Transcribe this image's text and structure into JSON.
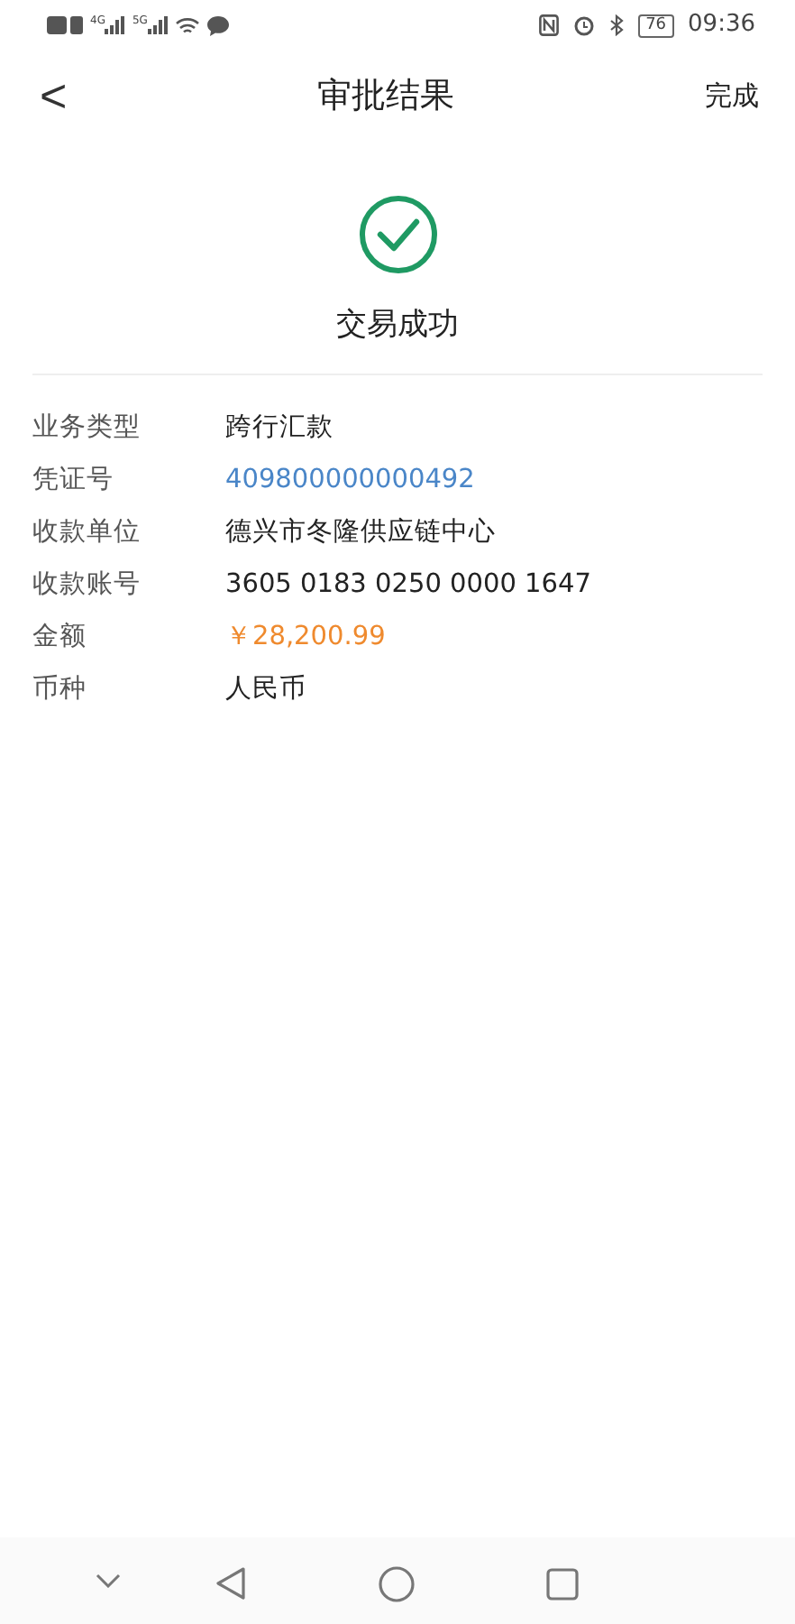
{
  "status_bar": {
    "signals": [
      {
        "label": "4G"
      },
      {
        "label": "5G"
      }
    ],
    "battery": "76",
    "time": "09:36"
  },
  "nav": {
    "back": "<",
    "title": "审批结果",
    "action": "完成"
  },
  "result": {
    "title": "交易成功",
    "success": true
  },
  "details": [
    {
      "label": "业务类型",
      "value": "跨行汇款",
      "kind": "plain"
    },
    {
      "label": "凭证号",
      "value": "409800000000492",
      "kind": "link"
    },
    {
      "label": "收款单位",
      "value": "德兴市冬隆供应链中心",
      "kind": "plain"
    },
    {
      "label": "收款账号",
      "value": "3605 0183 0250 0000 1647",
      "kind": "plain"
    },
    {
      "label": "金额",
      "value": "￥28,200.99",
      "kind": "amount"
    },
    {
      "label": "币种",
      "value": "人民币",
      "kind": "plain"
    }
  ]
}
